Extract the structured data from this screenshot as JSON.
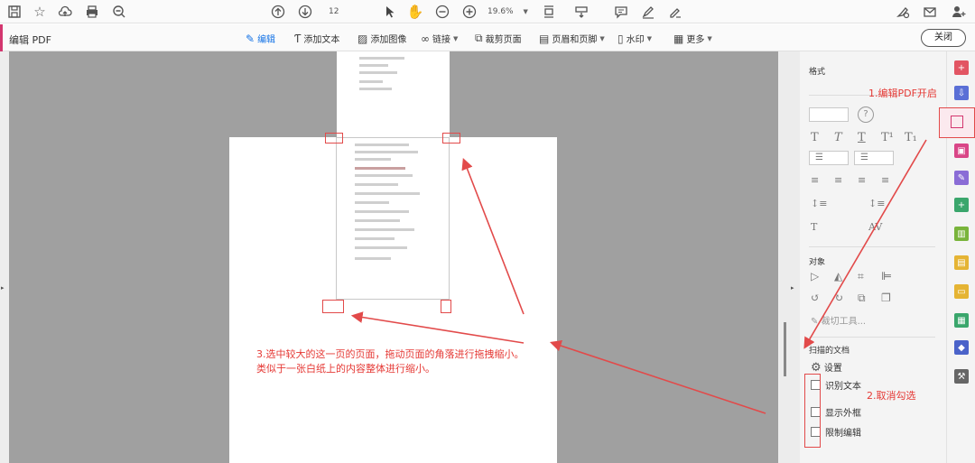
{
  "topbar": {
    "page_number": "12",
    "zoom": "19.6%"
  },
  "editbar": {
    "mode_label": "编辑 PDF",
    "tools": {
      "edit": "编辑",
      "add_text": "添加文本",
      "add_image": "添加图像",
      "link": "链接",
      "crop": "裁剪页面",
      "header_footer": "页眉和页脚",
      "watermark": "水印",
      "more": "更多"
    },
    "close_label": "关闭"
  },
  "panel": {
    "format_title": "格式",
    "objects_title": "对象",
    "crop_tool_label": "裁切工具...",
    "scanned_title": "扫描的文档",
    "settings_label": "设置",
    "recognize_text": "识别文本",
    "show_outline": "显示外框",
    "restrict_edit": "限制编辑"
  },
  "annotations": {
    "step1": "1.编辑PDF开启",
    "step2": "2.取消勾选",
    "step3_line1": "3.选中较大的这一页的页面，拖动页面的角落进行拖拽缩小。",
    "step3_line2": "类似于一张白纸上的内容整体进行缩小。"
  },
  "colors": {
    "accent": "#d3366f",
    "active_tool": "#1473e6",
    "annotation": "#e53935",
    "canvas": "#a0a0a0"
  }
}
